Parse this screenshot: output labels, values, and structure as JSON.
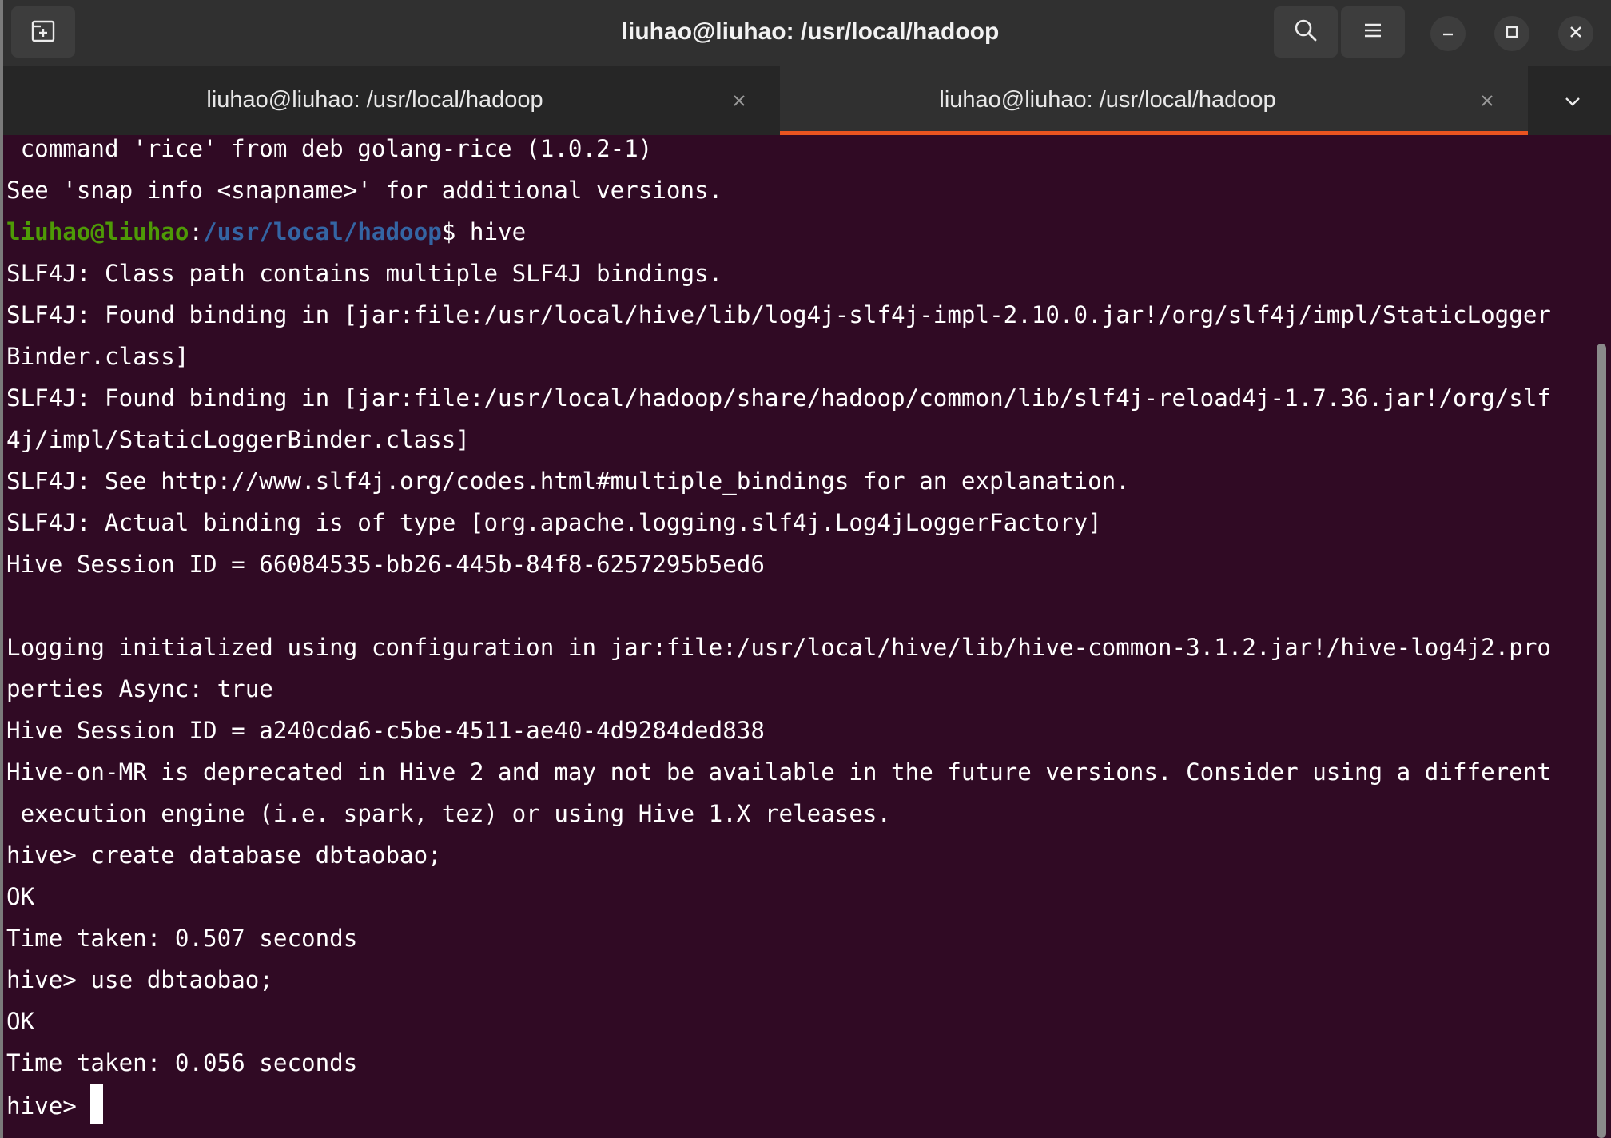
{
  "window": {
    "title": "liuhao@liuhao: /usr/local/hadoop"
  },
  "icons": {
    "new_tab": "new-tab-icon",
    "search": "search-icon",
    "menu": "hamburger-menu-icon",
    "minimize": "minimize-icon",
    "maximize": "maximize-icon",
    "close": "close-icon",
    "tab_close": "close-icon",
    "tabs_dropdown": "chevron-down-icon"
  },
  "colors": {
    "terminal_bg": "#300a24",
    "tab_accent": "#e95420",
    "prompt_user": "#4e9a06",
    "prompt_path": "#3465a4"
  },
  "tabs": [
    {
      "label": "liuhao@liuhao: /usr/local/hadoop",
      "active": false
    },
    {
      "label": "liuhao@liuhao: /usr/local/hadoop",
      "active": true
    }
  ],
  "terminal": {
    "lines": [
      " command 'rice' from deb golang-rice (1.0.2-1)",
      "See 'snap info <snapname>' for additional versions.",
      "",
      "SLF4J: Class path contains multiple SLF4J bindings.",
      "SLF4J: Found binding in [jar:file:/usr/local/hive/lib/log4j-slf4j-impl-2.10.0.jar!/org/slf4j/impl/StaticLogger",
      "Binder.class]",
      "SLF4J: Found binding in [jar:file:/usr/local/hadoop/share/hadoop/common/lib/slf4j-reload4j-1.7.36.jar!/org/slf",
      "4j/impl/StaticLoggerBinder.class]",
      "SLF4J: See http://www.slf4j.org/codes.html#multiple_bindings for an explanation.",
      "SLF4J: Actual binding is of type [org.apache.logging.slf4j.Log4jLoggerFactory]",
      "Hive Session ID = 66084535-bb26-445b-84f8-6257295b5ed6",
      "",
      "Logging initialized using configuration in jar:file:/usr/local/hive/lib/hive-common-3.1.2.jar!/hive-log4j2.pro",
      "perties Async: true",
      "Hive Session ID = a240cda6-c5be-4511-ae40-4d9284ded838",
      "Hive-on-MR is deprecated in Hive 2 and may not be available in the future versions. Consider using a different",
      " execution engine (i.e. spark, tez) or using Hive 1.X releases.",
      "hive> create database dbtaobao;",
      "OK",
      "Time taken: 0.507 seconds",
      "hive> use dbtaobao;",
      "OK",
      "Time taken: 0.056 seconds"
    ],
    "shell_prompt": {
      "user_host": "liuhao@liuhao",
      "separator": ":",
      "path": "/usr/local/hadoop",
      "symbol": "$",
      "command": " hive"
    },
    "current_prompt": "hive> "
  }
}
